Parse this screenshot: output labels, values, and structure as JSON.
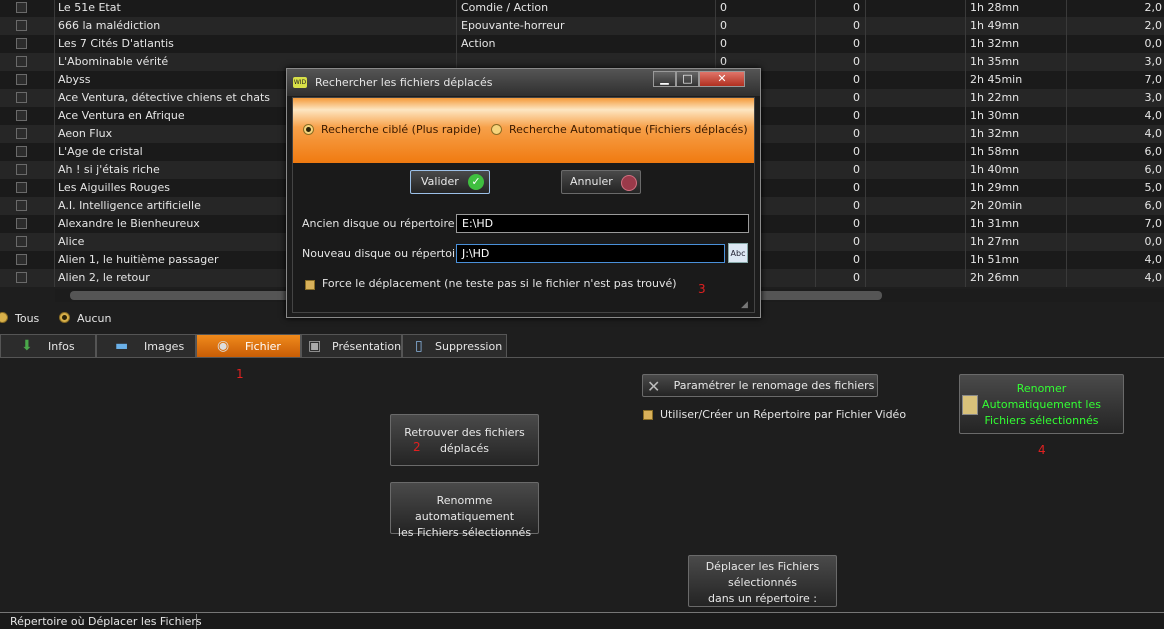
{
  "table": {
    "rows": [
      {
        "title": "Le 51e Etat",
        "genre": "Comdie / Action",
        "c3": "0",
        "c4": "0",
        "c5": "",
        "duration": "1h 28mn",
        "rating": "2,0"
      },
      {
        "title": "666 la malédiction",
        "genre": "Epouvante-horreur",
        "c3": "0",
        "c4": "0",
        "c5": "",
        "duration": "1h 49mn",
        "rating": "2,0"
      },
      {
        "title": "Les 7 Cités D'atlantis",
        "genre": "Action",
        "c3": "0",
        "c4": "0",
        "c5": "",
        "duration": "1h 32mn",
        "rating": "0,0"
      },
      {
        "title": "L'Abominable vérité",
        "genre": "",
        "c3": "0",
        "c4": "0",
        "c5": "",
        "duration": "1h 35mn",
        "rating": "3,0"
      },
      {
        "title": "Abyss",
        "genre": "",
        "c3": "",
        "c4": "0",
        "c5": "",
        "duration": "2h 45min",
        "rating": "7,0"
      },
      {
        "title": "Ace Ventura, détective chiens et chats",
        "genre": "",
        "c3": "",
        "c4": "0",
        "c5": "",
        "duration": "1h 22mn",
        "rating": "3,0"
      },
      {
        "title": "Ace Ventura en Afrique",
        "genre": "",
        "c3": "",
        "c4": "0",
        "c5": "",
        "duration": "1h 30mn",
        "rating": "4,0"
      },
      {
        "title": "Aeon Flux",
        "genre": "",
        "c3": "",
        "c4": "0",
        "c5": "",
        "duration": "1h 32mn",
        "rating": "4,0"
      },
      {
        "title": "L'Age de cristal",
        "genre": "",
        "c3": "",
        "c4": "0",
        "c5": "",
        "duration": "1h 58mn",
        "rating": "6,0"
      },
      {
        "title": "Ah ! si j'étais riche",
        "genre": "",
        "c3": "",
        "c4": "0",
        "c5": "",
        "duration": "1h 40mn",
        "rating": "6,0"
      },
      {
        "title": "Les Aiguilles Rouges",
        "genre": "",
        "c3": "",
        "c4": "0",
        "c5": "",
        "duration": "1h 29mn",
        "rating": "5,0"
      },
      {
        "title": "A.I. Intelligence artificielle",
        "genre": "",
        "c3": "",
        "c4": "0",
        "c5": "",
        "duration": "2h 20min",
        "rating": "6,0"
      },
      {
        "title": "Alexandre le Bienheureux",
        "genre": "",
        "c3": "",
        "c4": "0",
        "c5": "",
        "duration": "1h 31mn",
        "rating": "7,0"
      },
      {
        "title": "Alice",
        "genre": "",
        "c3": "",
        "c4": "0",
        "c5": "",
        "duration": "1h 27mn",
        "rating": "0,0"
      },
      {
        "title": "Alien 1, le huitième passager",
        "genre": "",
        "c3": "",
        "c4": "0",
        "c5": "",
        "duration": "1h 51mn",
        "rating": "4,0"
      },
      {
        "title": "Alien 2, le retour",
        "genre": "",
        "c3": "",
        "c4": "0",
        "c5": "",
        "duration": "2h 26mn",
        "rating": "4,0"
      }
    ]
  },
  "filter": {
    "all_label": "Tous",
    "none_label": "Aucun"
  },
  "tabs": {
    "infos": "Infos",
    "images": "Images",
    "fichier": "Fichier",
    "presentation": "Présentation",
    "suppression": "Suppression"
  },
  "panel": {
    "rename_params": "Paramétrer le renomage des fichiers",
    "use_create_dir": "Utiliser/Créer un Répertoire par Fichier Vidéo",
    "retrouver_line1": "Retrouver des fichiers",
    "retrouver_line2": "déplacés",
    "renomme_line1": "Renomme automatiquement",
    "renomme_line2": "les Fichiers sélectionnés",
    "deplacer_line1": "Déplacer les Fichiers",
    "deplacer_line2": "sélectionnés",
    "deplacer_line3": "dans un répertoire :",
    "renommer_line1": "Renomer",
    "renommer_line2": "Automatiquement les",
    "renommer_line3": "Fichiers sélectionnés",
    "marker1": "1",
    "marker2": "2",
    "marker3": "3",
    "marker4": "4"
  },
  "bottom": {
    "label": "Répertoire où Déplacer les Fichiers"
  },
  "dialog": {
    "title": "Rechercher les fichiers déplacés",
    "app_badge": "WID",
    "radio1": "Recherche ciblé (Plus rapide)",
    "radio2": "Recherche Automatique (Fichiers déplacés)",
    "validate": "Valider",
    "cancel": "Annuler",
    "old_label": "Ancien disque ou répertoire",
    "old_value": "E:\\HD",
    "new_label": "Nouveau disque ou répertoire",
    "new_value": "J:\\HD",
    "spell_icon_text": "Abc",
    "force_label": "Force le déplacement (ne teste pas si le fichier n'est pas trouvé)"
  },
  "colors": {
    "accent": "#f07a10",
    "marker": "#e02020",
    "green_text": "#33ff33"
  }
}
